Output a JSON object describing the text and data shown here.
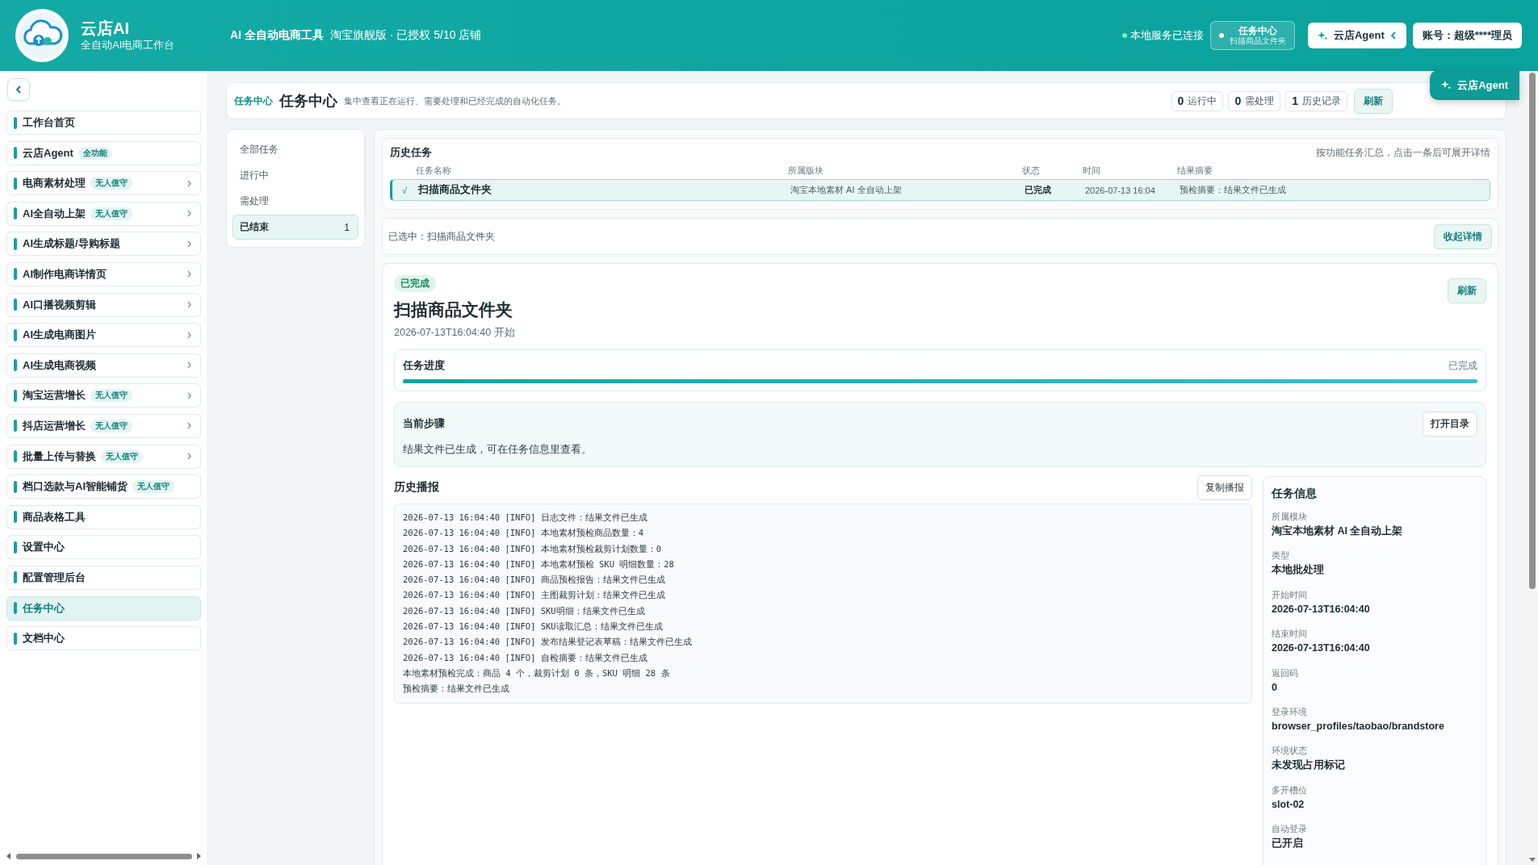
{
  "header": {
    "app_name": "云店AI",
    "tagline": "全自动AI电商工作台",
    "product": "AI 全自动电商工具",
    "edition": "淘宝旗舰版 · 已授权 5/10 店铺",
    "service_status": "本地服务已连接",
    "service_connected": true,
    "task_chip": {
      "title": "任务中心",
      "subtitle": "扫描商品文件夹"
    },
    "agent_button": "云店Agent",
    "account": "账号：超级****理员"
  },
  "sidebar": {
    "items": [
      {
        "label": "工作台首页",
        "has_submenu": false,
        "selected": false
      },
      {
        "label": "云店Agent",
        "badge": "全功能",
        "has_submenu": false,
        "selected": false
      },
      {
        "label": "电商素材处理",
        "badge": "无人值守",
        "has_submenu": true,
        "selected": false
      },
      {
        "label": "AI全自动上架",
        "badge": "无人值守",
        "has_submenu": true,
        "selected": false
      },
      {
        "label": "AI生成标题/导购标题",
        "has_submenu": true,
        "selected": false
      },
      {
        "label": "AI制作电商详情页",
        "has_submenu": true,
        "selected": false
      },
      {
        "label": "AI口播视频剪辑",
        "has_submenu": true,
        "selected": false
      },
      {
        "label": "AI生成电商图片",
        "has_submenu": true,
        "selected": false
      },
      {
        "label": "AI生成电商视频",
        "has_submenu": true,
        "selected": false
      },
      {
        "label": "淘宝运营增长",
        "badge": "无人值守",
        "has_submenu": true,
        "selected": false
      },
      {
        "label": "抖店运营增长",
        "badge": "无人值守",
        "has_submenu": true,
        "selected": false
      },
      {
        "label": "批量上传与替换",
        "badge": "无人值守",
        "has_submenu": true,
        "selected": false
      },
      {
        "label": "档口选款与AI智能铺货",
        "badge": "无人值守",
        "has_submenu": false,
        "selected": false
      },
      {
        "label": "商品表格工具",
        "has_submenu": false,
        "selected": false
      },
      {
        "label": "设置中心",
        "has_submenu": false,
        "selected": false
      },
      {
        "label": "配置管理后台",
        "has_submenu": false,
        "selected": false
      },
      {
        "label": "任务中心",
        "has_submenu": false,
        "selected": true
      },
      {
        "label": "文档中心",
        "has_submenu": false,
        "selected": false
      }
    ]
  },
  "page": {
    "breadcrumb": "任务中心",
    "title": "任务中心",
    "description": "集中查看正在运行、需要处理和已经完成的自动化任务。",
    "stats": [
      {
        "count": "0",
        "label": "运行中"
      },
      {
        "count": "0",
        "label": "需处理"
      },
      {
        "count": "1",
        "label": "历史记录"
      }
    ],
    "refresh_button": "刷新"
  },
  "filters": [
    {
      "label": "全部任务",
      "selected": false
    },
    {
      "label": "进行中",
      "selected": false
    },
    {
      "label": "需处理",
      "selected": false
    },
    {
      "label": "已结束",
      "count": "1",
      "selected": true
    }
  ],
  "history": {
    "title": "历史任务",
    "hint": "按功能任务汇总，点击一条后可展开详情",
    "columns": [
      "任务名称",
      "所属版块",
      "状态",
      "时间",
      "结果摘要"
    ],
    "rows": [
      {
        "mark": "√",
        "name": "扫描商品文件夹",
        "module": "淘宝本地素材 AI 全自动上架",
        "status": "已完成",
        "time": "2026-07-13 16:04",
        "summary": "预检摘要：结果文件已生成",
        "selected": true
      }
    ]
  },
  "selection": {
    "text": "已选中：扫描商品文件夹",
    "collapse_button": "收起详情"
  },
  "detail": {
    "status_badge": "已完成",
    "title": "扫描商品文件夹",
    "started": "2026-07-13T16:04:40 开始",
    "refresh_button": "刷新",
    "progress": {
      "title": "任务进度",
      "state": "已完成",
      "level": 1
    },
    "current_step": {
      "title": "当前步骤",
      "text": "结果文件已生成，可在任务信息里查看。",
      "open_button": "打开目录"
    },
    "log": {
      "title": "历史播报",
      "copy_button": "复制播报",
      "lines": [
        "2026-07-13 16:04:40 [INFO] 日志文件：结果文件已生成",
        "2026-07-13 16:04:40 [INFO] 本地素材预检商品数量：4",
        "2026-07-13 16:04:40 [INFO] 本地素材预检裁剪计划数量：0",
        "2026-07-13 16:04:40 [INFO] 本地素材预检 SKU 明细数量：28",
        "2026-07-13 16:04:40 [INFO] 商品预检报告：结果文件已生成",
        "2026-07-13 16:04:40 [INFO] 主图裁剪计划：结果文件已生成",
        "2026-07-13 16:04:40 [INFO] SKU明细：结果文件已生成",
        "2026-07-13 16:04:40 [INFO] SKU读取汇总：结果文件已生成",
        "2026-07-13 16:04:40 [INFO] 发布结果登记表草稿：结果文件已生成",
        "2026-07-13 16:04:40 [INFO] 自检摘要：结果文件已生成",
        "本地素材预检完成：商品 4 个，裁剪计划 0 条，SKU 明细 28 条",
        "预检摘要：结果文件已生成"
      ]
    },
    "info": {
      "title": "任务信息",
      "fields": [
        {
          "label": "所属模块",
          "value": "淘宝本地素材 AI 全自动上架"
        },
        {
          "label": "类型",
          "value": "本地批处理"
        },
        {
          "label": "开始时间",
          "value": "2026-07-13T16:04:40"
        },
        {
          "label": "结束时间",
          "value": "2026-07-13T16:04:40"
        },
        {
          "label": "返回码",
          "value": "0"
        },
        {
          "label": "登录环境",
          "value": "browser_profiles/taobao/brandstore"
        },
        {
          "label": "环境状态",
          "value": "未发现占用标记"
        },
        {
          "label": "多开槽位",
          "value": "slot-02"
        },
        {
          "label": "自动登录",
          "value": "已开启"
        }
      ]
    }
  },
  "agent_fab": "云店Agent"
}
